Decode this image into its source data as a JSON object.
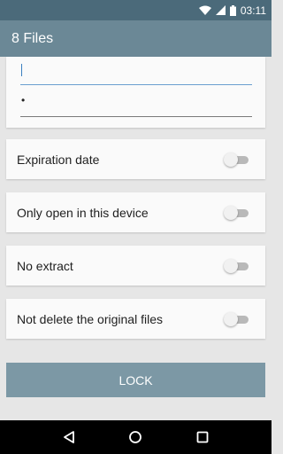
{
  "status_bar": {
    "time": "03:11",
    "icons": [
      "wifi-icon",
      "signal-icon",
      "battery-icon"
    ]
  },
  "app_bar": {
    "title": "8 Files"
  },
  "password_fields": [
    {
      "value": ""
    },
    {
      "value": "•"
    }
  ],
  "options": [
    {
      "label": "Expiration date",
      "enabled": false
    },
    {
      "label": "Only open in this device",
      "enabled": false
    },
    {
      "label": "No extract",
      "enabled": false
    },
    {
      "label": "Not delete the original files",
      "enabled": false
    }
  ],
  "lock_button": {
    "label": "LOCK"
  },
  "nav_bar": {
    "icons": [
      "back-icon",
      "home-icon",
      "recents-icon"
    ]
  },
  "colors": {
    "status_bar": "#4b6a7a",
    "app_bar": "#6b8896",
    "button": "#7c98a5",
    "focus_underline": "#6a9fcf"
  }
}
